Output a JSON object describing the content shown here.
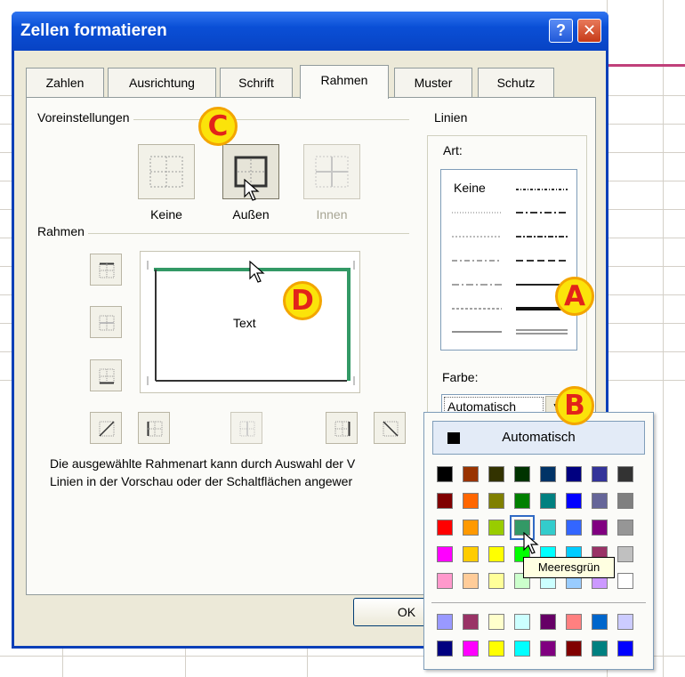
{
  "dialog": {
    "title": "Zellen formatieren",
    "help_label": "?",
    "close_label": "✕"
  },
  "tabs": [
    {
      "label": "Zahlen"
    },
    {
      "label": "Ausrichtung"
    },
    {
      "label": "Schrift"
    },
    {
      "label": "Rahmen",
      "active": true
    },
    {
      "label": "Muster"
    },
    {
      "label": "Schutz"
    }
  ],
  "presets": {
    "group_label": "Voreinstellungen",
    "none_label": "Keine",
    "outline_label": "Außen",
    "inside_label": "Innen"
  },
  "border": {
    "group_label": "Rahmen",
    "preview_text": "Text"
  },
  "lines": {
    "group_label": "Linien",
    "style_label": "Art:",
    "none_label": "Keine",
    "color_label": "Farbe:",
    "color_value": "Automatisch"
  },
  "info_text_line1": "Die ausgewählte Rahmenart kann durch Auswahl der V",
  "info_text_line2": "Linien in der Vorschau oder der Schaltflächen angewer",
  "ok_label": "OK",
  "palette": {
    "auto_label": "Automatisch",
    "tooltip": "Meeresgrün",
    "rows": [
      [
        "#000000",
        "#993300",
        "#333300",
        "#003300",
        "#003366",
        "#000080",
        "#333399",
        "#333333"
      ],
      [
        "#800000",
        "#ff6600",
        "#808000",
        "#008000",
        "#008080",
        "#0000ff",
        "#666699",
        "#808080"
      ],
      [
        "#ff0000",
        "#ff9900",
        "#99cc00",
        "#339966",
        "#33cccc",
        "#3366ff",
        "#800080",
        "#969696"
      ],
      [
        "#ff00ff",
        "#ffcc00",
        "#ffff00",
        "#00ff00",
        "#00ffff",
        "#00ccff",
        "#993366",
        "#c0c0c0"
      ],
      [
        "#ff99cc",
        "#ffcc99",
        "#ffff99",
        "#ccffcc",
        "#ccffff",
        "#99ccff",
        "#cc99ff",
        "#ffffff"
      ],
      [
        "#9999ff",
        "#993366",
        "#ffffcc",
        "#ccffff",
        "#660066",
        "#ff8080",
        "#0066cc",
        "#ccccff"
      ],
      [
        "#000080",
        "#ff00ff",
        "#ffff00",
        "#00ffff",
        "#800080",
        "#800000",
        "#008080",
        "#0000ff"
      ]
    ]
  },
  "callouts": {
    "a": "A",
    "b": "B",
    "c": "C",
    "d": "D"
  },
  "colors": {
    "title_bar": "#0a4fd6",
    "preview_border": "#339966",
    "badge_fill": "#fbe30a",
    "badge_text": "#e2231a"
  }
}
